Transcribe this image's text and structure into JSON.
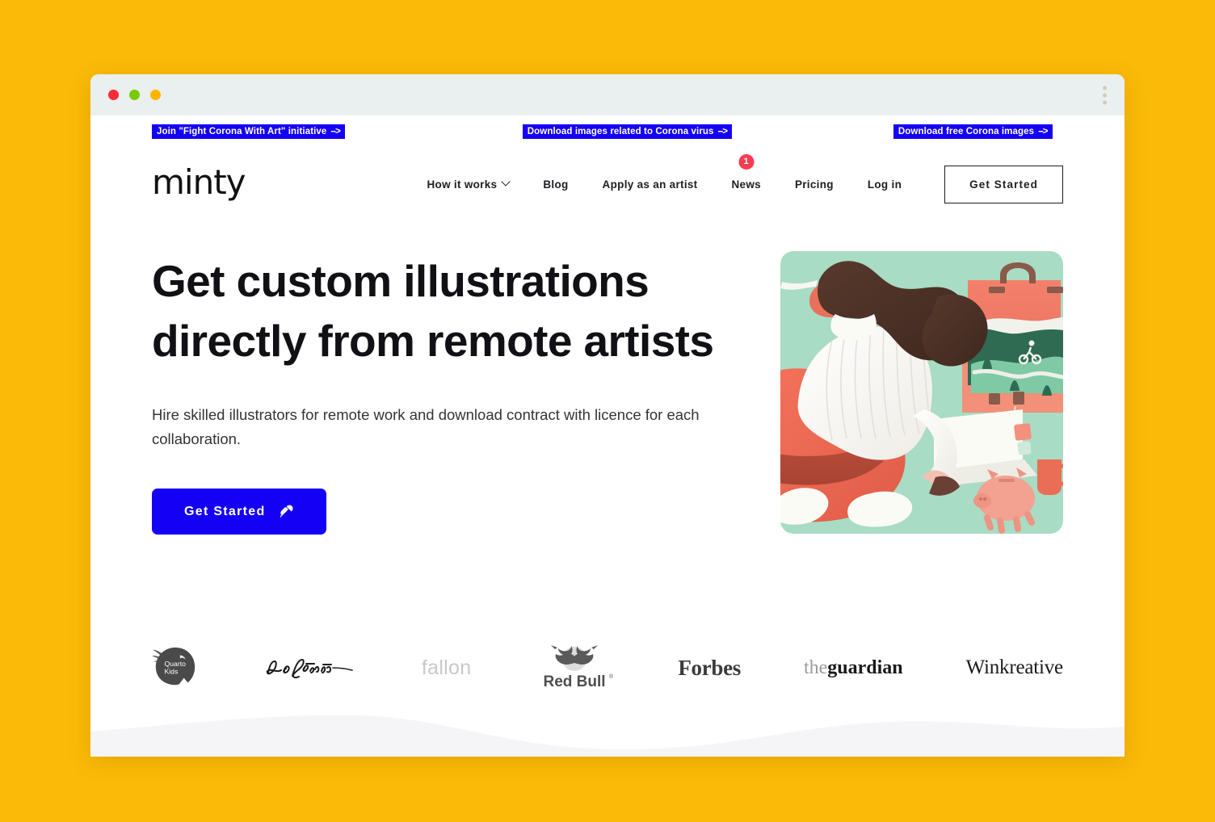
{
  "theme": {
    "page_background": "#FBBA07",
    "accent_blue": "#1400F5",
    "badge_red": "#FA3B4E",
    "illustration_background": "#A8DCC4",
    "titlebar": "#EAEFEF"
  },
  "window_controls": {
    "close_label": "close",
    "minimize_label": "minimize",
    "maximize_label": "maximize",
    "menu_label": "more-options"
  },
  "ticker": {
    "items": [
      {
        "text": "Join \"Fight Corona With Art\" initiative",
        "arrow": "-->"
      },
      {
        "text": "Download images related to Corona virus",
        "arrow": "-->"
      },
      {
        "text": "Download free Corona images",
        "arrow": "-->"
      }
    ]
  },
  "nav": {
    "logo": "minty",
    "links": [
      {
        "label": "How it works",
        "has_dropdown": true,
        "badge": null
      },
      {
        "label": "Blog",
        "has_dropdown": false,
        "badge": null
      },
      {
        "label": "Apply as an artist",
        "has_dropdown": false,
        "badge": null
      },
      {
        "label": "News",
        "has_dropdown": false,
        "badge": "1"
      },
      {
        "label": "Pricing",
        "has_dropdown": false,
        "badge": null
      },
      {
        "label": "Log in",
        "has_dropdown": false,
        "badge": null
      }
    ],
    "cta_label": "Get Started"
  },
  "hero": {
    "headline_line1": "Get custom illustrations",
    "headline_line2": "directly from remote artists",
    "subtitle": "Hire skilled illustrators for remote work and download contract with licence for each collaboration.",
    "cta_label": "Get Started",
    "cta_icon": "plug-icon",
    "illustration_alt": "Woman in white sweater and coral trousers working on a laptop beside a piggy bank, mug and an open suitcase containing a green landscape"
  },
  "brands": [
    {
      "name": "Quarto Kids",
      "icon": "quarto-kids-logo"
    },
    {
      "name": "Leo Burnett",
      "icon": "leo-burnett-logo"
    },
    {
      "name": "fallon",
      "icon": "fallon-logo"
    },
    {
      "name": "Red Bull",
      "icon": "red-bull-logo"
    },
    {
      "name": "Forbes",
      "icon": "forbes-logo"
    },
    {
      "name": "theguardian",
      "icon": "guardian-logo",
      "the": "the",
      "guardian": "guardian"
    },
    {
      "name": "Winkreative",
      "icon": "winkreative-logo"
    }
  ]
}
